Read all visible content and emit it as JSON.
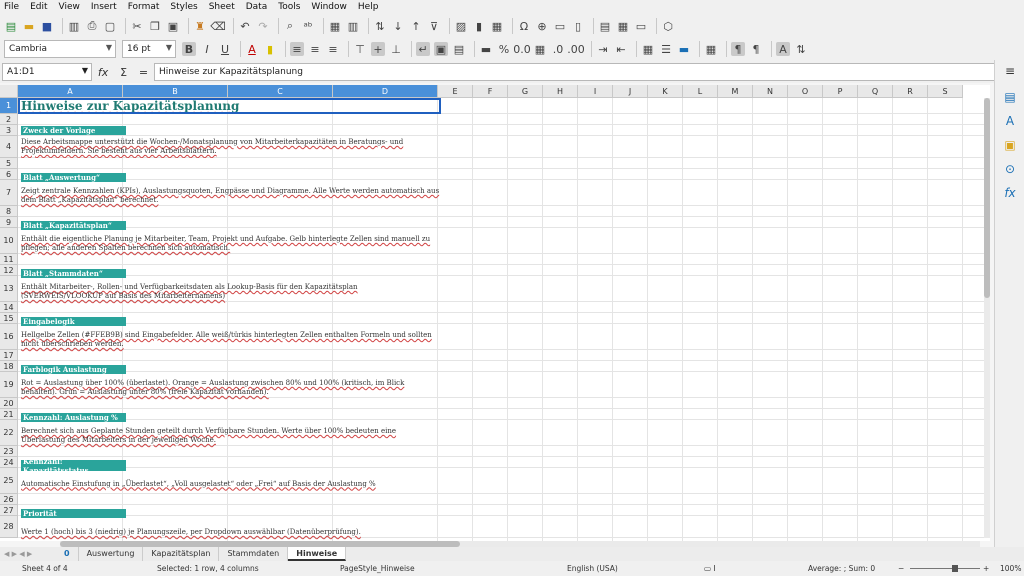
{
  "menu": [
    "File",
    "Edit",
    "View",
    "Insert",
    "Format",
    "Styles",
    "Sheet",
    "Data",
    "Tools",
    "Window",
    "Help"
  ],
  "format_bar": {
    "font_name": "Cambria",
    "font_size": "16 pt"
  },
  "formula_bar": {
    "cell_ref": "A1:D1",
    "content": "Hinweise zur Kapazitätsplanung"
  },
  "columns": [
    "A",
    "B",
    "C",
    "D",
    "E",
    "F",
    "G",
    "H",
    "I",
    "J",
    "K",
    "L",
    "M",
    "N",
    "O",
    "P",
    "Q",
    "R",
    "S"
  ],
  "rows": [
    "1",
    "2",
    "3",
    "4",
    "5",
    "6",
    "7",
    "8",
    "9",
    "10",
    "11",
    "12",
    "13",
    "14",
    "15",
    "16",
    "17",
    "18",
    "19",
    "20",
    "21",
    "22",
    "23",
    "24",
    "25",
    "26",
    "27",
    "28"
  ],
  "content": {
    "title": "Hinweise zur Kapazitätsplanung",
    "s1_head": "Zweck der Vorlage",
    "s1_text": "Diese Arbeitsmappe unterstützt die Wochen-/Monatsplanung von Mitarbeiterkapazitäten in Beratungs- und Projektumfeldern. Sie besteht aus vier Arbeitsblättern.",
    "s2_head": "Blatt „Auswertung“",
    "s2_text": "Zeigt zentrale Kennzahlen (KPIs), Auslastungsquoten, Engpässe und Diagramme. Alle Werte werden automatisch aus dem Blatt „Kapazitätsplan“ berechnet.",
    "s3_head": "Blatt „Kapazitätsplan“",
    "s3_text": "Enthält die eigentliche Planung je Mitarbeiter, Team, Projekt und Aufgabe. Gelb hinterlegte Zellen sind manuell zu pflegen; alle anderen Spalten berechnen sich automatisch.",
    "s4_head": "Blatt „Stammdaten“",
    "s4_text": "Enthält Mitarbeiter-, Rollen- und Verfügbarkeitsdaten als Lookup-Basis für den Kapazitätsplan (SVERWEIS/VLOOKUP auf Basis des Mitarbeiternamens)",
    "s5_head": "Eingabelogik",
    "s5_text": "Hellgelbe Zellen (#FFEB9B) sind Eingabefelder. Alle weiß/türkis hinterlegten Zellen enthalten Formeln und sollten nicht überschrieben werden.",
    "s6_head": "Farblogik Auslastung",
    "s6_text": "Rot = Auslastung über 100% (überlastet). Orange = Auslastung zwischen 80% und 100% (kritisch, im Blick behalten). Grün = Auslastung unter 80% (freie Kapazität vorhanden).",
    "s7_head": "Kennzahl: Auslastung %",
    "s7_text": "Berechnet sich aus Geplante Stunden geteilt durch Verfügbare Stunden. Werte über 100% bedeuten eine Überlastung des Mitarbeiters in der jeweiligen Woche.",
    "s8_head": "Kennzahl: Kapazitätsstatus",
    "s8_text": "Automatische Einstufung in „Überlastet“, „Voll ausgelastet“ oder „Frei“ auf Basis der Auslastung %",
    "s9_head": "Priorität",
    "s9_text": "Werte 1 (hoch) bis 3 (niedrig) je Planungszeile, per Dropdown auswählbar (Datenüberprüfung)."
  },
  "tabs": {
    "zero": "0",
    "t1": "Auswertung",
    "t2": "Kapazitätsplan",
    "t3": "Stammdaten",
    "t4": "Hinweise"
  },
  "status": {
    "sheet": "Sheet 4 of 4",
    "selection": "Selected: 1 row, 4 columns",
    "pagestyle": "PageStyle_Hinweise",
    "lang": "English (USA)",
    "sum": "Average: ; Sum: 0",
    "zoom": "100%"
  },
  "colors": {
    "section_header": "#2aa49b",
    "title": "#1f7a72",
    "selection": "#4a90d9"
  }
}
